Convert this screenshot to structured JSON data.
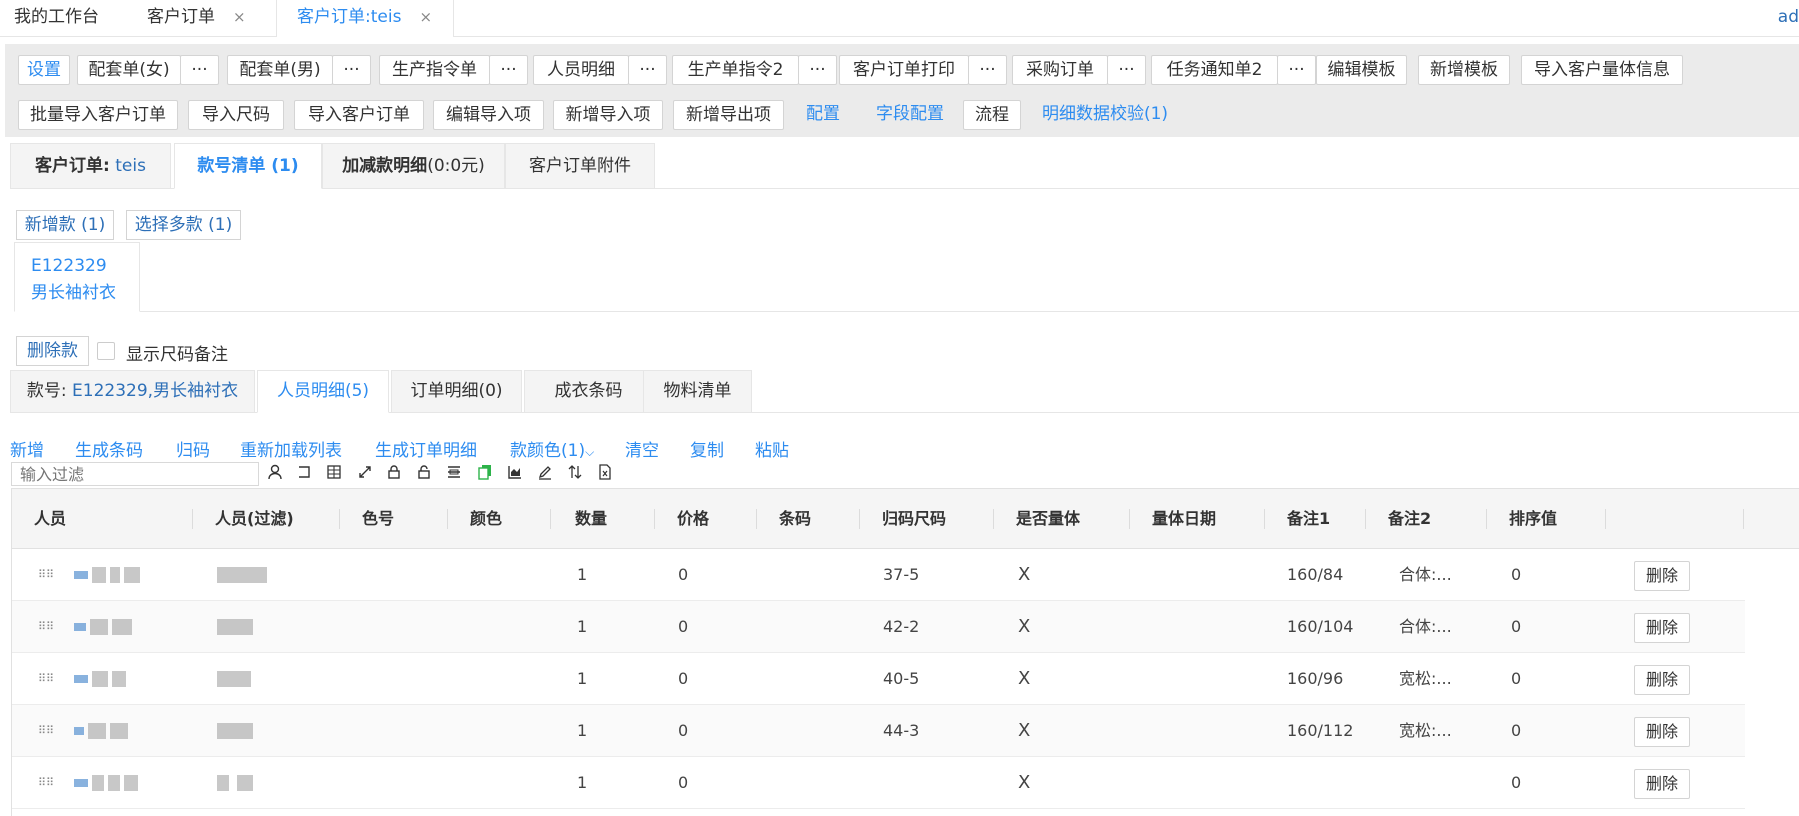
{
  "top_tabs": [
    {
      "label": "我的工作台",
      "closable": false
    },
    {
      "label": "客户订单",
      "closable": true
    },
    {
      "label": "客户订单:teis",
      "closable": true,
      "active": true
    }
  ],
  "close_glyph": "×",
  "user_label": "ad",
  "toolbar": {
    "row1": [
      "设置",
      "配套单(女)",
      "配套单(男)",
      "生产指令单",
      "人员明细",
      "生产单指令2",
      "客户订单打印",
      "采购订单",
      "任务通知单2",
      "编辑模板",
      "新增模板",
      "导入客户量体信息"
    ],
    "more_glyph": "···",
    "row2": [
      "批量导入客户订单",
      "导入尺码",
      "导入客户订单",
      "编辑导入项",
      "新增导入项",
      "新增导出项"
    ],
    "row2_links": [
      "配置",
      "字段配置",
      "流程",
      "明细数据校验(1)"
    ]
  },
  "order_tabs": {
    "order_label": "客户订单:",
    "order_value": "teis",
    "style_list": "款号清单 (1)",
    "adjust_label": "加减款明细",
    "adjust_value": "(0:0元)",
    "attachments": "客户订单附件"
  },
  "style_actions": {
    "add": "新增款 (1)",
    "select_multi": "选择多款 (1)"
  },
  "style_card": {
    "code": "E122329",
    "name": "男长袖衬衣"
  },
  "delete_style": "删除款",
  "show_size_note": "显示尺码备注",
  "detail_tabs": {
    "style_label": "款号: ",
    "style_value": "E122329,男长袖衬衣",
    "personnel": "人员明细(5)",
    "order_detail": "订单明细(0)",
    "garment_barcode": "成衣条码",
    "material_list": "物料清单"
  },
  "actions": [
    "新增",
    "生成条码",
    "归码",
    "重新加载列表",
    "生成订单明细",
    "款颜色(1)",
    "清空",
    "复制",
    "粘贴"
  ],
  "dropdown_glyph": "⌵",
  "filter_placeholder": "输入过滤",
  "table_icons": [
    "user-icon",
    "bracket-icon",
    "columns-icon",
    "expand-icon",
    "lock-icon",
    "unlock-icon",
    "list-icon",
    "copy-icon",
    "chart-icon",
    "edit-icon",
    "sort-icon",
    "excel-icon"
  ],
  "columns": [
    "人员",
    "人员(过滤)",
    "色号",
    "颜色",
    "数量",
    "价格",
    "条码",
    "归码尺码",
    "是否量体",
    "量体日期",
    "备注1",
    "备注2",
    "排序值"
  ],
  "rows": [
    {
      "qty": "1",
      "price": "0",
      "size": "37-5",
      "measured": "X",
      "note1": "160/84",
      "note2": "合体:...",
      "sort": "0"
    },
    {
      "qty": "1",
      "price": "0",
      "size": "42-2",
      "measured": "X",
      "note1": "160/104",
      "note2": "合体:...",
      "sort": "0"
    },
    {
      "qty": "1",
      "price": "0",
      "size": "40-5",
      "measured": "X",
      "note1": "160/96",
      "note2": "宽松:...",
      "sort": "0"
    },
    {
      "qty": "1",
      "price": "0",
      "size": "44-3",
      "measured": "X",
      "note1": "160/112",
      "note2": "宽松:...",
      "sort": "0"
    },
    {
      "qty": "1",
      "price": "0",
      "size": "",
      "measured": "X",
      "note1": "",
      "note2": "",
      "sort": "0"
    }
  ],
  "delete_row": "删除",
  "colors": {
    "accent": "#2d8cf0",
    "link_dark": "#2d6fb7",
    "toolbar_bg": "#ebebeb"
  }
}
